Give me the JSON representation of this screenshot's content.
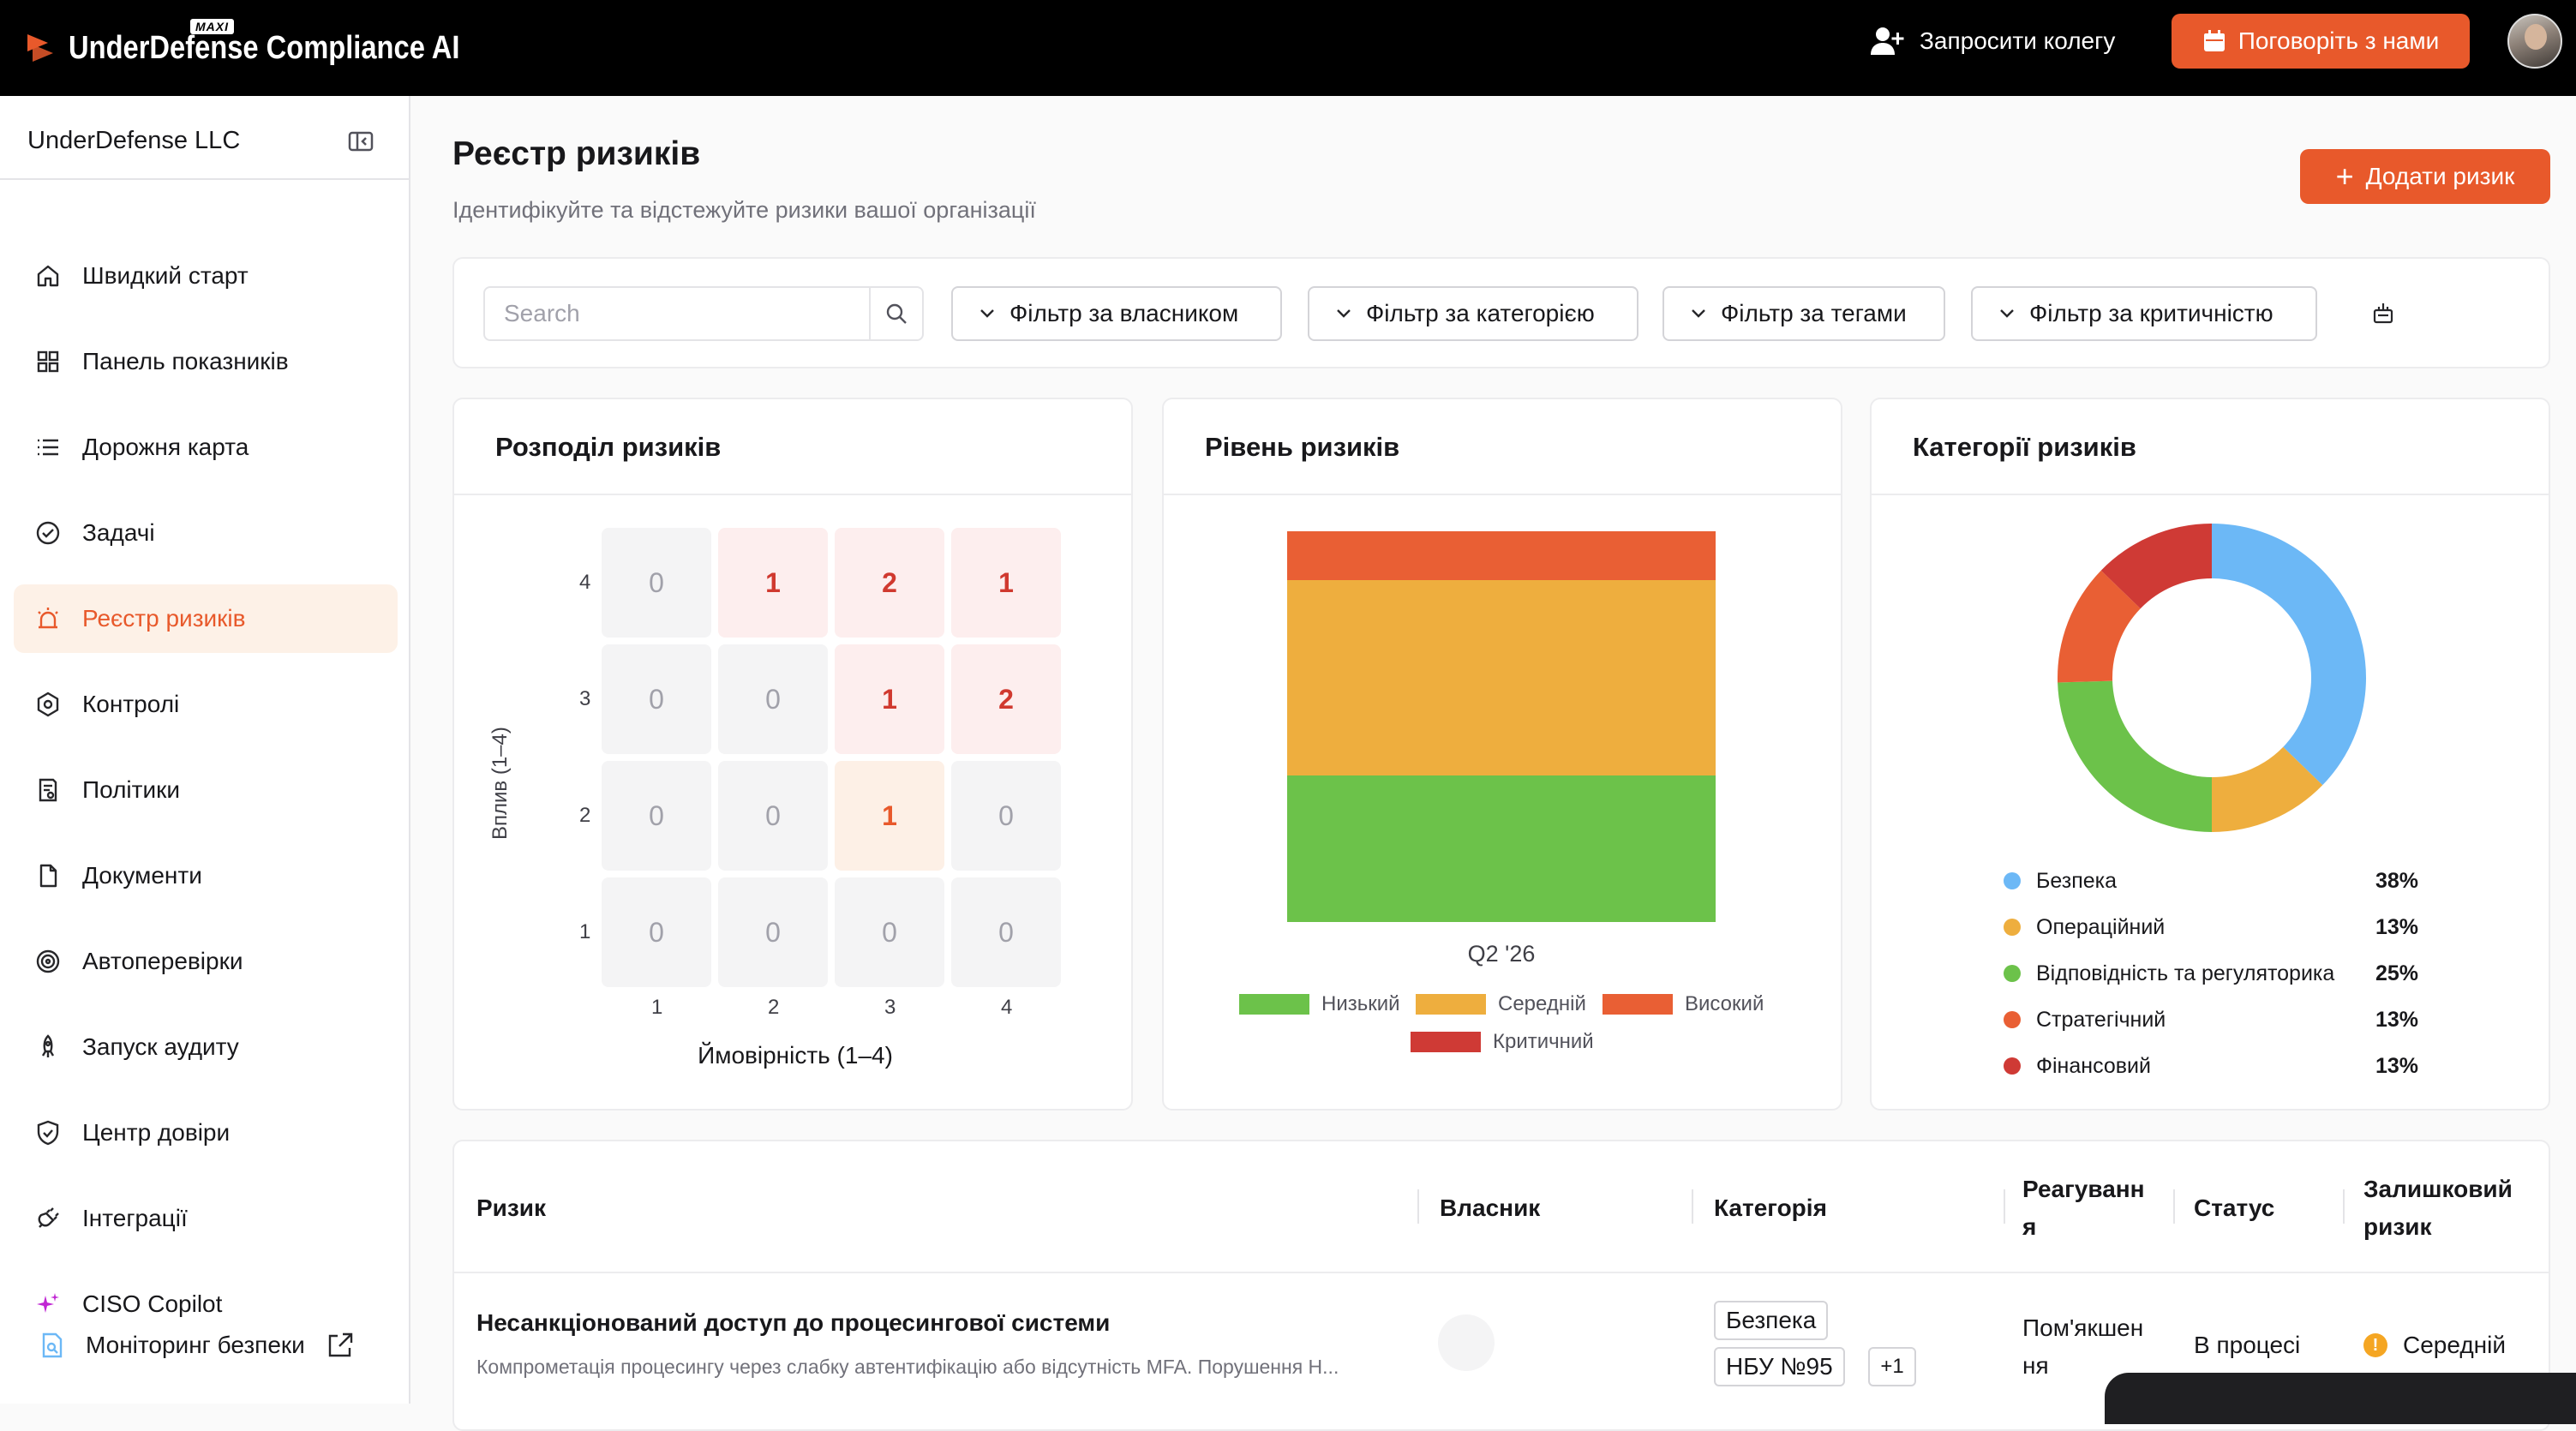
{
  "header": {
    "brand": "UnderDefense Compliance AI",
    "brand_badge": "MAXI",
    "invite_label": "Запросити колегу",
    "talk_label": "Поговоріть з нами",
    "accent": "#e8592b"
  },
  "sidebar": {
    "org": "UnderDefense LLC",
    "items": [
      {
        "label": "Швидкий старт",
        "icon": "home-icon"
      },
      {
        "label": "Панель показників",
        "icon": "dashboard-icon"
      },
      {
        "label": "Дорожня карта",
        "icon": "list-icon"
      },
      {
        "label": "Задачі",
        "icon": "check-circle-icon"
      },
      {
        "label": "Реєстр ризиків",
        "icon": "alarm-icon"
      },
      {
        "label": "Контролі",
        "icon": "hexagon-icon"
      },
      {
        "label": "Політики",
        "icon": "policy-icon"
      },
      {
        "label": "Документи",
        "icon": "document-icon"
      },
      {
        "label": "Автоперевірки",
        "icon": "radar-icon"
      },
      {
        "label": "Запуск аудиту",
        "icon": "rocket-icon"
      },
      {
        "label": "Центр довіри",
        "icon": "shield-icon"
      },
      {
        "label": "Інтеграції",
        "icon": "plug-icon"
      },
      {
        "label": "CISO Copilot",
        "icon": "sparkle-icon"
      }
    ],
    "active_index": 4,
    "monitoring": "Моніторинг безпеки"
  },
  "page": {
    "title": "Реєстр ризиків",
    "subtitle": "Ідентифікуйте та відстежуйте ризики вашої організації",
    "add_label": "Додати ризик"
  },
  "filters": {
    "search_placeholder": "Search",
    "owner": "Фільтр за власником",
    "category": "Фільтр за категорією",
    "tags": "Фільтр за тегами",
    "criticality": "Фільтр за критичністю"
  },
  "distribution": {
    "title": "Розподіл ризиків",
    "y_label": "Вплив (1–4)",
    "x_label": "Ймовірність (1–4)",
    "y_ticks": [
      "4",
      "3",
      "2",
      "1"
    ],
    "x_ticks": [
      "1",
      "2",
      "3",
      "4"
    ],
    "rows": [
      [
        "0",
        "1",
        "2",
        "1"
      ],
      [
        "0",
        "0",
        "1",
        "2"
      ],
      [
        "0",
        "0",
        "1",
        "0"
      ],
      [
        "0",
        "0",
        "0",
        "0"
      ]
    ]
  },
  "level": {
    "title": "Рівень ризиків",
    "x_tick": "Q2 '26",
    "legend": [
      "Низький",
      "Середній",
      "Високий",
      "Критичний"
    ]
  },
  "categories": {
    "title": "Категорії ризиків",
    "items": [
      {
        "name": "Безпека",
        "pct": "38%",
        "color": "#6cb8f6"
      },
      {
        "name": "Операційний",
        "pct": "13%",
        "color": "#eeae3e"
      },
      {
        "name": "Відповідність та регуляторика",
        "pct": "25%",
        "color": "#6cc24a"
      },
      {
        "name": "Стратегічний",
        "pct": "13%",
        "color": "#e95f34"
      },
      {
        "name": "Фінансовий",
        "pct": "13%",
        "color": "#cf3a35"
      }
    ]
  },
  "chart_data": [
    {
      "type": "heatmap",
      "title": "Розподіл ризиків",
      "xlabel": "Ймовірність (1–4)",
      "ylabel": "Вплив (1–4)",
      "x": [
        1,
        2,
        3,
        4
      ],
      "y": [
        4,
        3,
        2,
        1
      ],
      "values": [
        [
          0,
          1,
          2,
          1
        ],
        [
          0,
          0,
          1,
          2
        ],
        [
          0,
          0,
          1,
          0
        ],
        [
          0,
          0,
          0,
          0
        ]
      ]
    },
    {
      "type": "bar",
      "stacked": true,
      "title": "Рівень ризиків",
      "categories": [
        "Q2 '26"
      ],
      "series": [
        {
          "name": "Низький",
          "values": [
            3
          ],
          "color": "#6cc24a"
        },
        {
          "name": "Середній",
          "values": [
            4
          ],
          "color": "#eeae3e"
        },
        {
          "name": "Високий",
          "values": [
            1
          ],
          "color": "#e95f34"
        },
        {
          "name": "Критичний",
          "values": [
            0
          ],
          "color": "#cf3a35"
        }
      ],
      "legend_position": "bottom"
    },
    {
      "type": "pie",
      "donut": true,
      "title": "Категорії ризиків",
      "labels": [
        "Безпека",
        "Операційний",
        "Відповідність та регуляторика",
        "Стратегічний",
        "Фінансовий"
      ],
      "values": [
        38,
        13,
        25,
        13,
        13
      ],
      "colors": [
        "#6cb8f6",
        "#eeae3e",
        "#6cc24a",
        "#e95f34",
        "#cf3a35"
      ]
    }
  ],
  "table": {
    "headers": {
      "risk": "Ризик",
      "owner": "Власник",
      "category": "Категорія",
      "response_1": "Реагуванн",
      "response_2": "я",
      "status": "Статус",
      "residual_1": "Залишковий",
      "residual_2": "ризик"
    },
    "rows": [
      {
        "name": "Несанкціонований доступ до процесингової системи",
        "desc": "Компрометація процесингу через слабку автентифікацію або відсутність MFA. Порушення Н...",
        "tag1": "Безпека",
        "tag2": "НБУ №95",
        "more": "+1",
        "response_1": "Пом'якшен",
        "response_2": "ня",
        "status": "В процесі",
        "residual": "Середній"
      }
    ]
  }
}
